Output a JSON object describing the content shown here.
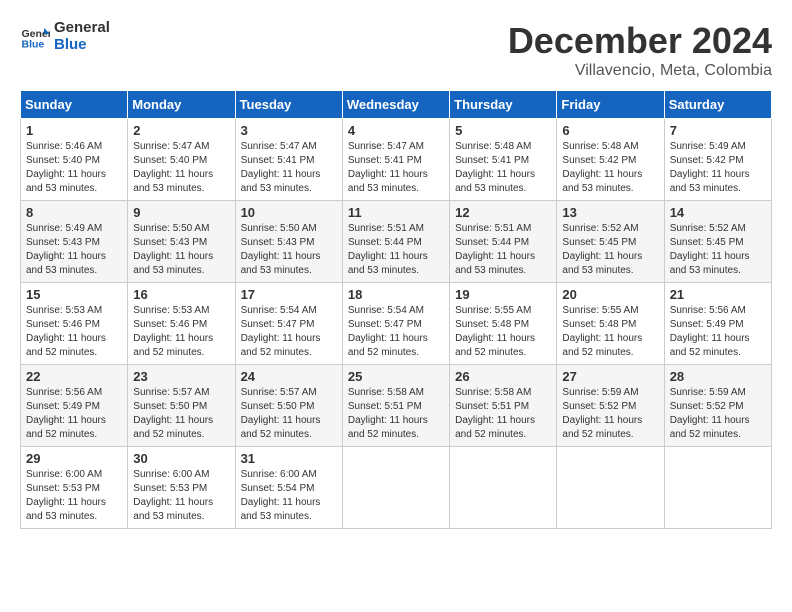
{
  "logo": {
    "line1": "General",
    "line2": "Blue"
  },
  "title": "December 2024",
  "subtitle": "Villavencio, Meta, Colombia",
  "days_of_week": [
    "Sunday",
    "Monday",
    "Tuesday",
    "Wednesday",
    "Thursday",
    "Friday",
    "Saturday"
  ],
  "weeks": [
    [
      {
        "day": "1",
        "sunrise": "5:46 AM",
        "sunset": "5:40 PM",
        "daylight": "11 hours and 53 minutes."
      },
      {
        "day": "2",
        "sunrise": "5:47 AM",
        "sunset": "5:40 PM",
        "daylight": "11 hours and 53 minutes."
      },
      {
        "day": "3",
        "sunrise": "5:47 AM",
        "sunset": "5:41 PM",
        "daylight": "11 hours and 53 minutes."
      },
      {
        "day": "4",
        "sunrise": "5:47 AM",
        "sunset": "5:41 PM",
        "daylight": "11 hours and 53 minutes."
      },
      {
        "day": "5",
        "sunrise": "5:48 AM",
        "sunset": "5:41 PM",
        "daylight": "11 hours and 53 minutes."
      },
      {
        "day": "6",
        "sunrise": "5:48 AM",
        "sunset": "5:42 PM",
        "daylight": "11 hours and 53 minutes."
      },
      {
        "day": "7",
        "sunrise": "5:49 AM",
        "sunset": "5:42 PM",
        "daylight": "11 hours and 53 minutes."
      }
    ],
    [
      {
        "day": "8",
        "sunrise": "5:49 AM",
        "sunset": "5:43 PM",
        "daylight": "11 hours and 53 minutes."
      },
      {
        "day": "9",
        "sunrise": "5:50 AM",
        "sunset": "5:43 PM",
        "daylight": "11 hours and 53 minutes."
      },
      {
        "day": "10",
        "sunrise": "5:50 AM",
        "sunset": "5:43 PM",
        "daylight": "11 hours and 53 minutes."
      },
      {
        "day": "11",
        "sunrise": "5:51 AM",
        "sunset": "5:44 PM",
        "daylight": "11 hours and 53 minutes."
      },
      {
        "day": "12",
        "sunrise": "5:51 AM",
        "sunset": "5:44 PM",
        "daylight": "11 hours and 53 minutes."
      },
      {
        "day": "13",
        "sunrise": "5:52 AM",
        "sunset": "5:45 PM",
        "daylight": "11 hours and 53 minutes."
      },
      {
        "day": "14",
        "sunrise": "5:52 AM",
        "sunset": "5:45 PM",
        "daylight": "11 hours and 53 minutes."
      }
    ],
    [
      {
        "day": "15",
        "sunrise": "5:53 AM",
        "sunset": "5:46 PM",
        "daylight": "11 hours and 52 minutes."
      },
      {
        "day": "16",
        "sunrise": "5:53 AM",
        "sunset": "5:46 PM",
        "daylight": "11 hours and 52 minutes."
      },
      {
        "day": "17",
        "sunrise": "5:54 AM",
        "sunset": "5:47 PM",
        "daylight": "11 hours and 52 minutes."
      },
      {
        "day": "18",
        "sunrise": "5:54 AM",
        "sunset": "5:47 PM",
        "daylight": "11 hours and 52 minutes."
      },
      {
        "day": "19",
        "sunrise": "5:55 AM",
        "sunset": "5:48 PM",
        "daylight": "11 hours and 52 minutes."
      },
      {
        "day": "20",
        "sunrise": "5:55 AM",
        "sunset": "5:48 PM",
        "daylight": "11 hours and 52 minutes."
      },
      {
        "day": "21",
        "sunrise": "5:56 AM",
        "sunset": "5:49 PM",
        "daylight": "11 hours and 52 minutes."
      }
    ],
    [
      {
        "day": "22",
        "sunrise": "5:56 AM",
        "sunset": "5:49 PM",
        "daylight": "11 hours and 52 minutes."
      },
      {
        "day": "23",
        "sunrise": "5:57 AM",
        "sunset": "5:50 PM",
        "daylight": "11 hours and 52 minutes."
      },
      {
        "day": "24",
        "sunrise": "5:57 AM",
        "sunset": "5:50 PM",
        "daylight": "11 hours and 52 minutes."
      },
      {
        "day": "25",
        "sunrise": "5:58 AM",
        "sunset": "5:51 PM",
        "daylight": "11 hours and 52 minutes."
      },
      {
        "day": "26",
        "sunrise": "5:58 AM",
        "sunset": "5:51 PM",
        "daylight": "11 hours and 52 minutes."
      },
      {
        "day": "27",
        "sunrise": "5:59 AM",
        "sunset": "5:52 PM",
        "daylight": "11 hours and 52 minutes."
      },
      {
        "day": "28",
        "sunrise": "5:59 AM",
        "sunset": "5:52 PM",
        "daylight": "11 hours and 52 minutes."
      }
    ],
    [
      {
        "day": "29",
        "sunrise": "6:00 AM",
        "sunset": "5:53 PM",
        "daylight": "11 hours and 53 minutes."
      },
      {
        "day": "30",
        "sunrise": "6:00 AM",
        "sunset": "5:53 PM",
        "daylight": "11 hours and 53 minutes."
      },
      {
        "day": "31",
        "sunrise": "6:00 AM",
        "sunset": "5:54 PM",
        "daylight": "11 hours and 53 minutes."
      },
      null,
      null,
      null,
      null
    ]
  ],
  "labels": {
    "sunrise": "Sunrise:",
    "sunset": "Sunset:",
    "daylight": "Daylight:"
  }
}
